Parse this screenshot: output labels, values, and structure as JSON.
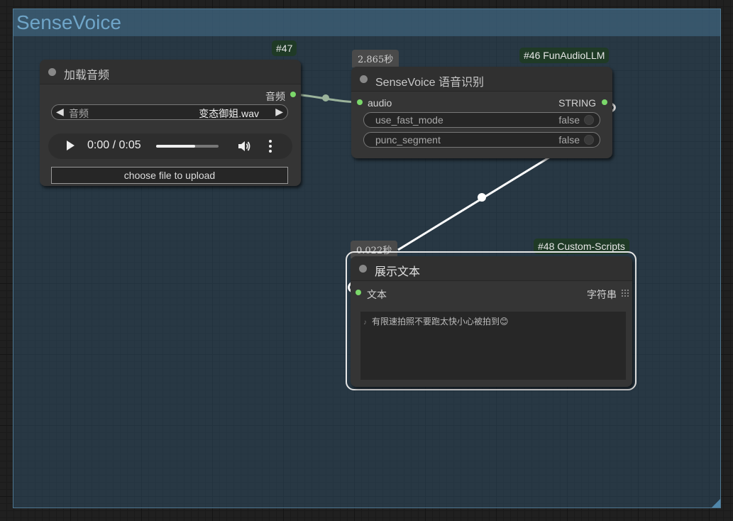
{
  "group": {
    "title": "SenseVoice"
  },
  "nodes": {
    "load_audio": {
      "badge": "#47",
      "title": "加载音频",
      "output_label": "音频",
      "combo": {
        "name": "音频",
        "value": "变态御姐.wav"
      },
      "player": {
        "time": "0:00 / 0:05",
        "progress_percent": 62
      },
      "upload_label": "choose file to upload"
    },
    "sensevoice": {
      "badge": "#46 FunAudioLLM",
      "exec_time": "2.865秒",
      "title": "SenseVoice 语音识别",
      "input_label": "audio",
      "output_label": "STRING",
      "widgets": [
        {
          "name": "use_fast_mode",
          "value": "false"
        },
        {
          "name": "punc_segment",
          "value": "false"
        }
      ]
    },
    "show_text": {
      "badge": "#48 Custom-Scripts",
      "exec_time": "0.022秒",
      "title": "展示文本",
      "input_label": "文本",
      "output_label": "字符串",
      "text": "有限速拍照不要跑太快小心被拍到😊"
    }
  },
  "colors": {
    "canvas_bg": "#202020",
    "group_bg": "#345670",
    "node_bg": "#353535",
    "slot_connected": "#7bd86a",
    "badge_bg": "#1f3a26"
  }
}
